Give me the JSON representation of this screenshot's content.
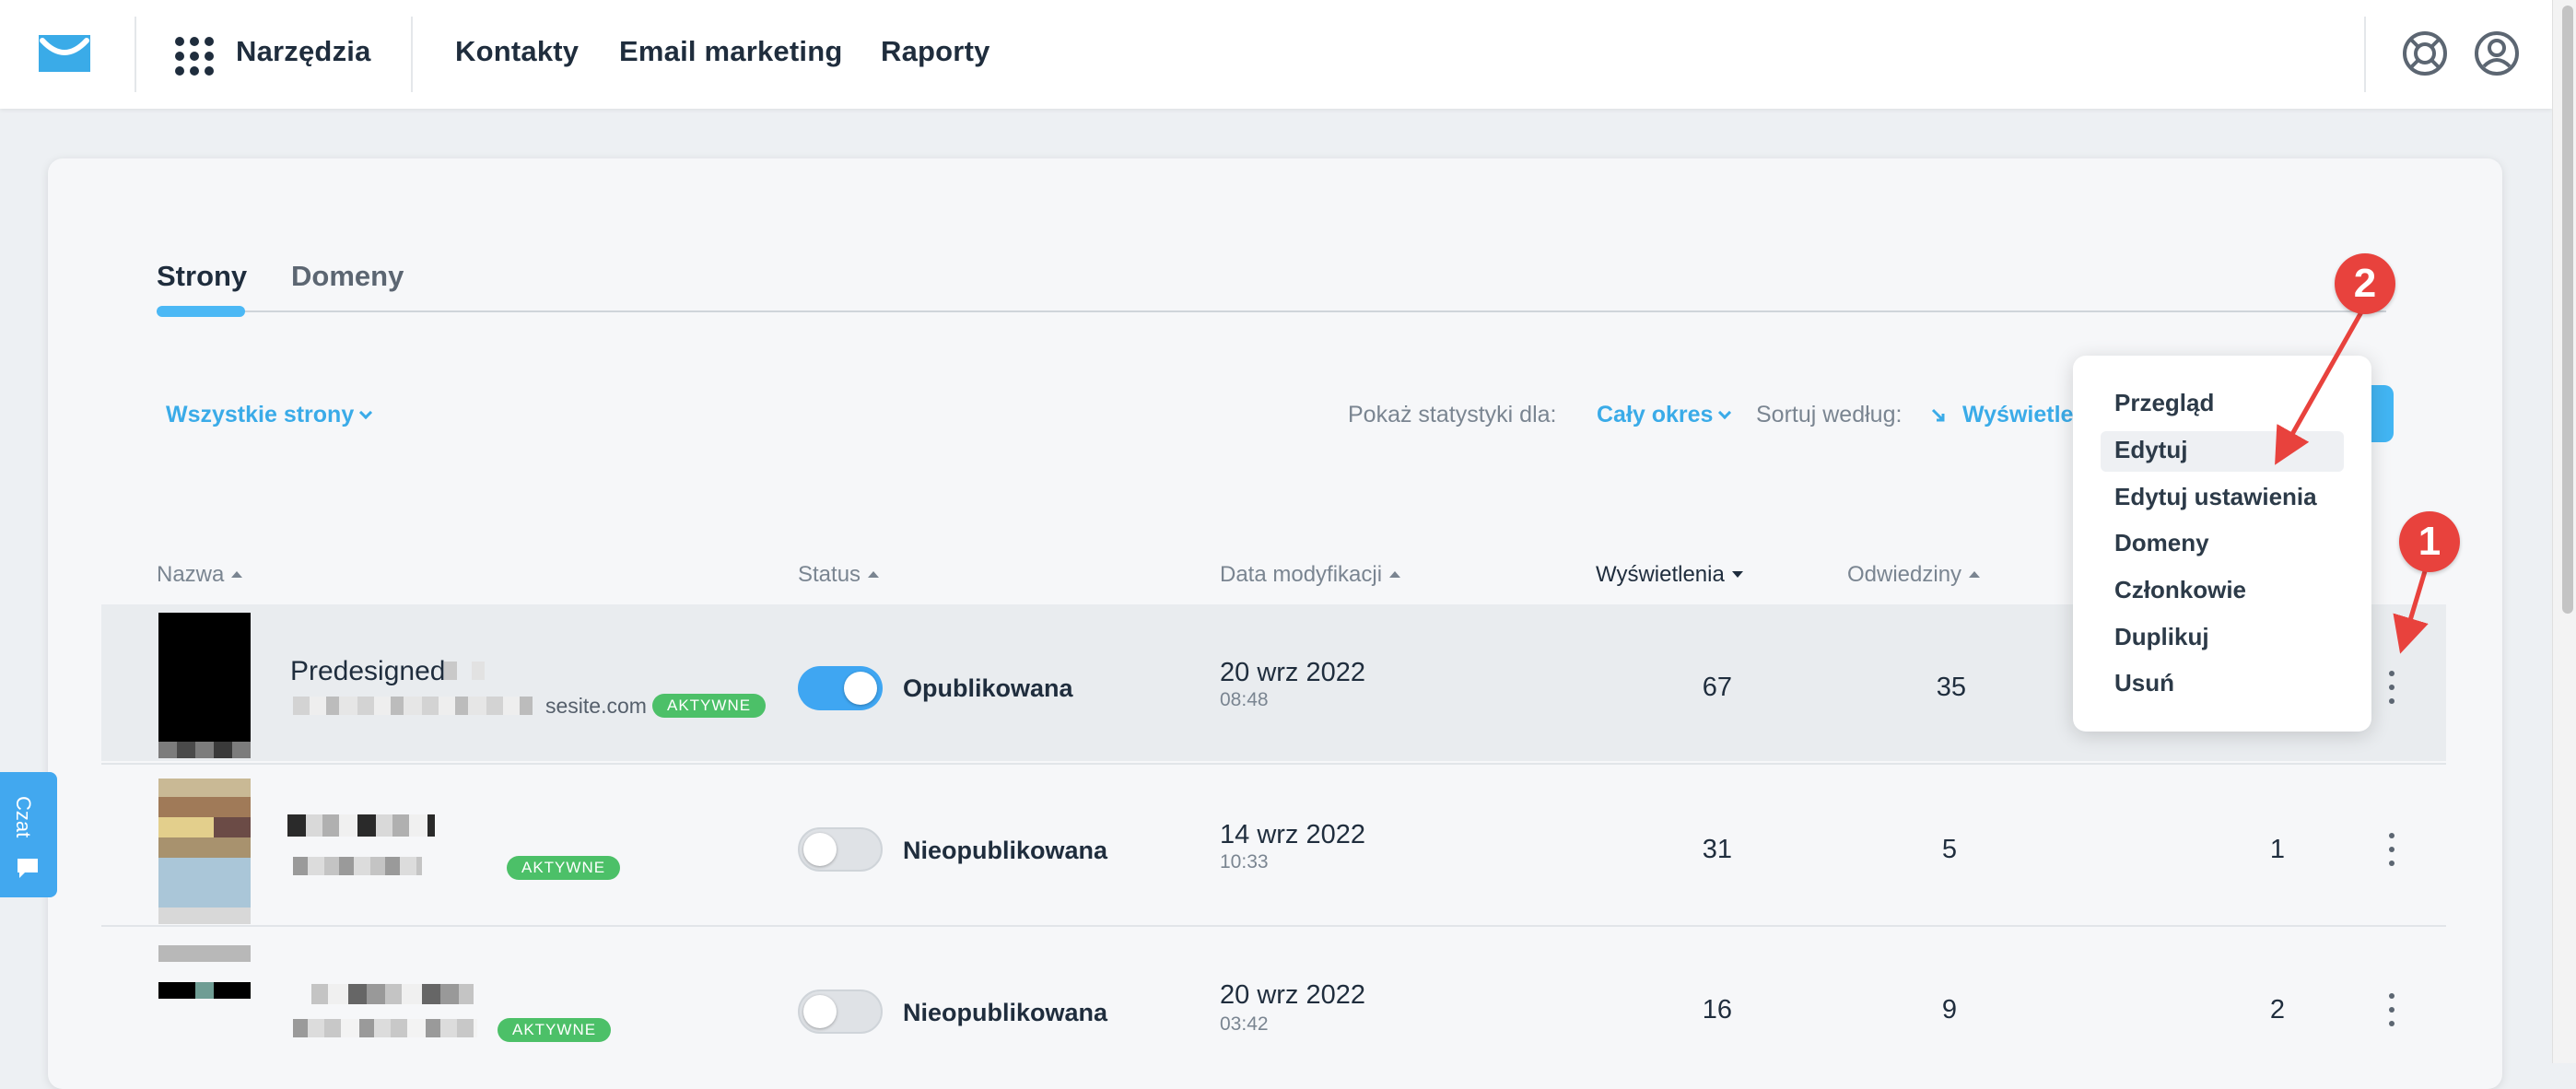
{
  "header": {
    "tools_label": "Narzędzia",
    "nav": [
      "Kontakty",
      "Email marketing",
      "Raporty"
    ]
  },
  "tabs": [
    {
      "label": "Strony",
      "active": true
    },
    {
      "label": "Domeny",
      "active": false
    }
  ],
  "filters": {
    "pages_filter": "Wszystkie strony",
    "stats_label": "Pokaż statystyki dla:",
    "stats_value": "Cały okres",
    "sort_label": "Sortuj według:",
    "sort_value": "Wyświetle"
  },
  "columns": {
    "name": "Nazwa",
    "status": "Status",
    "modified": "Data modyfikacji",
    "views": "Wyświetlenia",
    "visits": "Odwiedziny"
  },
  "rows": [
    {
      "name": "Predesigned",
      "domain": "sesite.com",
      "badge": "AKTYWNE",
      "published": true,
      "status": "Opublikowana",
      "date": "20 wrz 2022",
      "time": "08:48",
      "views": "67",
      "visits": "35",
      "col6": ""
    },
    {
      "name": "",
      "domain": "",
      "badge": "AKTYWNE",
      "published": false,
      "status": "Nieopublikowana",
      "date": "14 wrz 2022",
      "time": "10:33",
      "views": "31",
      "visits": "5",
      "col6": "1"
    },
    {
      "name": "",
      "domain": "",
      "badge": "AKTYWNE",
      "published": false,
      "status": "Nieopublikowana",
      "date": "20 wrz 2022",
      "time": "03:42",
      "views": "16",
      "visits": "9",
      "col6": "2"
    }
  ],
  "dropdown": {
    "items": [
      "Przegląd",
      "Edytuj",
      "Edytuj ustawienia",
      "Domeny",
      "Członkowie",
      "Duplikuj",
      "Usuń"
    ],
    "highlighted": "Edytuj"
  },
  "chat": {
    "label": "Czat"
  },
  "markers": [
    "1",
    "2"
  ],
  "colors": {
    "accent": "#3aabe8",
    "badge": "#4cc068",
    "marker": "#e8423d",
    "toggle_on": "#3fa6f2"
  }
}
